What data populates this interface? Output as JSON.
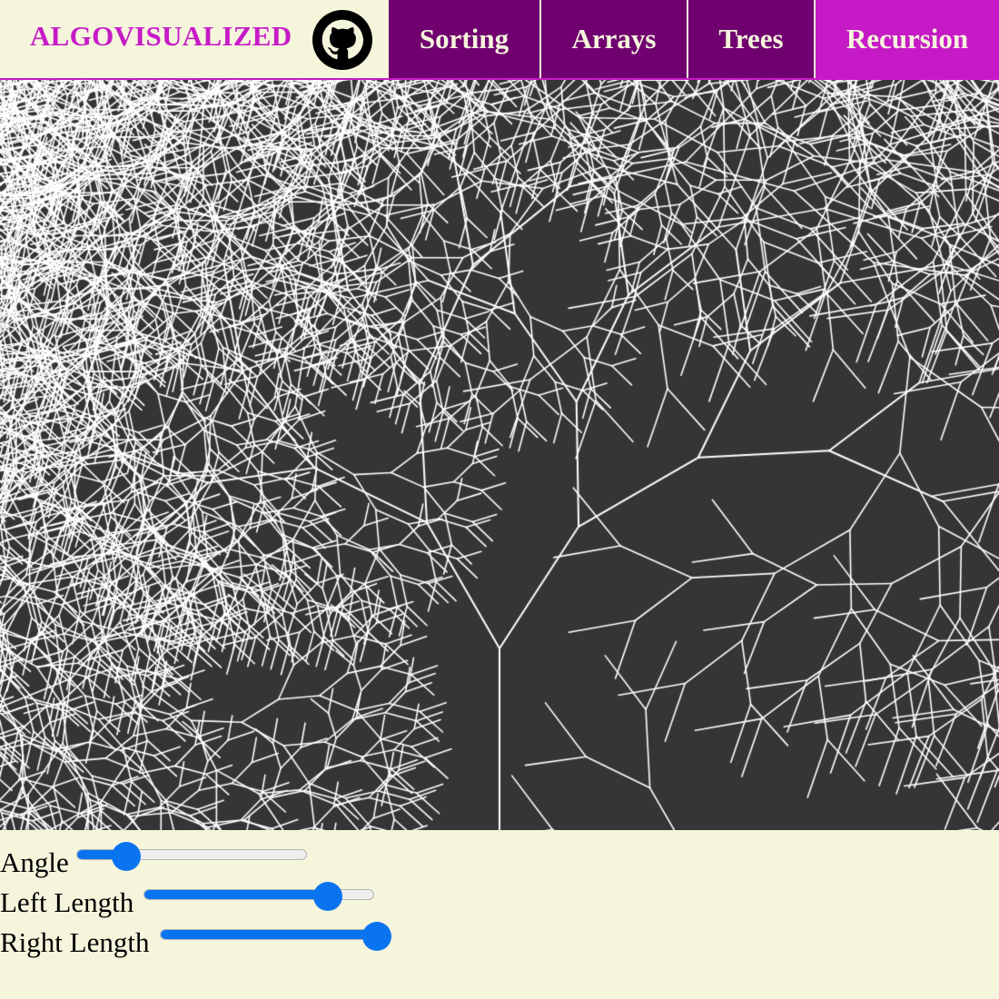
{
  "header": {
    "brand": "ALGOVISUALIZED",
    "github_icon": "github-icon",
    "nav": [
      {
        "label": "Sorting",
        "active": false
      },
      {
        "label": "Arrays",
        "active": false
      },
      {
        "label": "Trees",
        "active": false
      },
      {
        "label": "Recursion",
        "active": true
      }
    ]
  },
  "colors": {
    "page_background": "#f5f5dc",
    "brand": "#c71ac7",
    "nav_inactive": "#700070",
    "nav_active": "#c71ac7",
    "canvas_background": "#353535",
    "branch": "#ffffff",
    "slider_accent": "#0a74f0"
  },
  "controls": [
    {
      "label": "Angle",
      "value_fraction": 0.18
    },
    {
      "label": "Left Length",
      "value_fraction": 0.84
    },
    {
      "label": "Right Length",
      "value_fraction": 1.0
    }
  ]
}
